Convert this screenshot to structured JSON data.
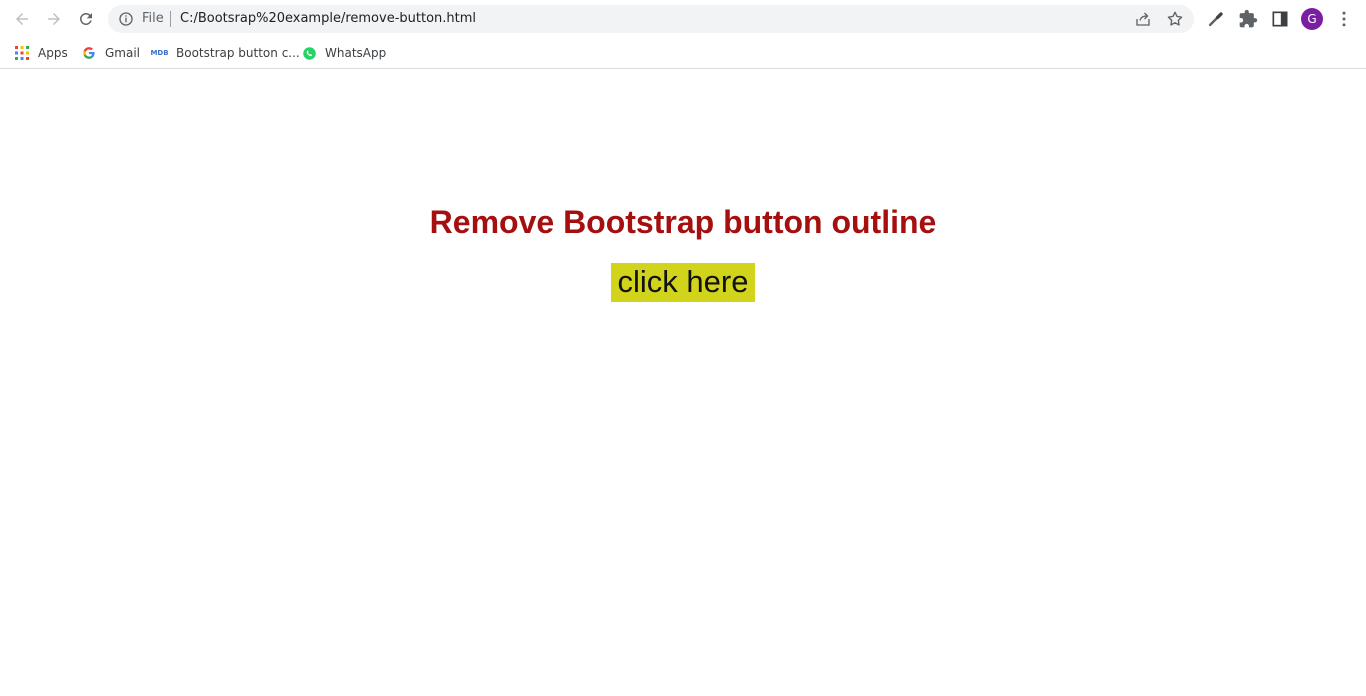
{
  "browser": {
    "address_bar": {
      "scheme_label": "File",
      "url": "C:/Bootsrap%20example/remove-button.html"
    },
    "profile_initial": "G",
    "profile_color": "#7b1fa2"
  },
  "bookmarks": [
    {
      "label": "Apps",
      "icon": "apps-grid-icon"
    },
    {
      "label": "Gmail",
      "icon": "google-icon"
    },
    {
      "label": "Bootstrap button c...",
      "icon": "mdb-icon"
    },
    {
      "label": "WhatsApp",
      "icon": "whatsapp-icon"
    }
  ],
  "page": {
    "heading": "Remove Bootstrap button outline",
    "heading_color": "#a50f0f",
    "button_label": "click here",
    "button_color": "#d1d41b"
  }
}
